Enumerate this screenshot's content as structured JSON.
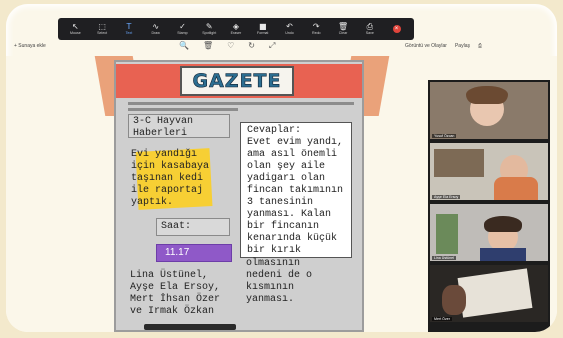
{
  "zoom_toolbar": {
    "tools": [
      {
        "icon": "↖",
        "label": "Mouse"
      },
      {
        "icon": "⬚",
        "label": "Select"
      },
      {
        "icon": "T",
        "label": "Text"
      },
      {
        "icon": "∿",
        "label": "Draw"
      },
      {
        "icon": "✓",
        "label": "Stamp"
      },
      {
        "icon": "✎",
        "label": "Spotlight"
      },
      {
        "icon": "◈",
        "label": "Eraser"
      },
      {
        "icon": "■",
        "label": "Format"
      },
      {
        "icon": "↶",
        "label": "Undo"
      },
      {
        "icon": "↷",
        "label": "Redo"
      },
      {
        "icon": "🗑",
        "label": "Clear"
      },
      {
        "icon": "⎙",
        "label": "Save"
      }
    ],
    "active_tool": "Text"
  },
  "whiteboard_bar": {
    "left_label": "+ Sunaya ekle",
    "view_label": "Görüntü ve Olaylar",
    "share_label": "Paylaş",
    "center_icons": [
      "🔍",
      "🗑",
      "♡",
      "↻",
      "⤢"
    ]
  },
  "newspaper": {
    "title": "GAZETE",
    "header_text": "3-C Hayvan Haberleri",
    "yellow_note": "Evi yandığı için kasabaya taşınan kedi ile raportaj yaptık.",
    "time_label": "Saat:",
    "time_value": "11.17",
    "authors": "Lina Üstünel, Ayşe Ela Ersoy, Mert İhsan Özer ve Irmak Özkan",
    "answers_label": "Cevaplar:",
    "answers_text": "Evet evim yandı, ama asıl önemli olan şey aile yadigarı olan fincan takımının 3 tanesinin yanması. Kalan bir fincanın kenarında küçük bir kırık",
    "answers_continued": "olmasının nedeni de o kısmının yanması."
  },
  "participants": [
    {
      "name": "Yusuf Özcan"
    },
    {
      "name": "Ayşe Ela Ersoy"
    },
    {
      "name": "Lina Üstünel"
    },
    {
      "name": "Mert Özer"
    }
  ]
}
